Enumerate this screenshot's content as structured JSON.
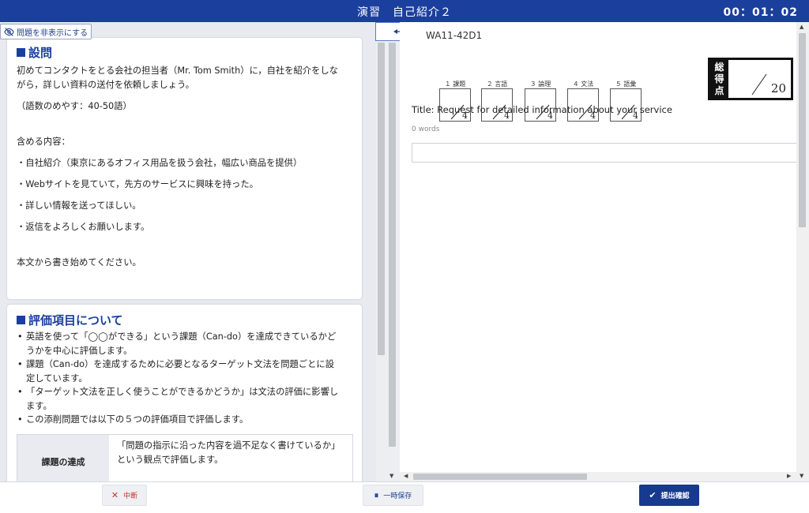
{
  "header": {
    "title": "演習　自己紹介２",
    "timer": "00：01：02"
  },
  "left": {
    "hide_button": "問題を非表示にする",
    "question_heading": "設問",
    "question_lines": [
      "初めてコンタクトをとる会社の担当者（Mr. Tom Smith）に，自社を紹介をしな",
      "がら，詳しい資料の送付を依頼しましょう。",
      "",
      "（語数のめやす：40-50語）",
      "",
      "",
      "",
      "含める内容：",
      "",
      "・自社紹介（東京にあるオフィス用品を扱う会社，幅広い商品を提供）",
      "",
      "・Webサイトを見ていて，先方のサービスに興味を持った。",
      "",
      "・詳しい情報を送ってほしい。",
      "",
      "・返信をよろしくお願いします。",
      "",
      "",
      "",
      "本文から書き始めてください。"
    ],
    "eval_heading": "評価項目について",
    "eval_items": [
      "英語を使って「◯◯ができる」という課題（Can-do）を達成できているかど",
      "うかを中心に評価します。",
      "課題（Can-do）を達成するために必要となるターゲット文法を問題ごとに設",
      "定しています。",
      "「ターゲット文法を正しく使うことができるかどうか」は文法の評価に影響し",
      "ます。",
      "この添削問題では以下の５つの評価項目で評価します。"
    ],
    "eval_table": {
      "header": "課題の達成",
      "desc_lines": [
        "「問題の指示に沿った内容を過不足なく書けているか」",
        "という観点で評価します。"
      ]
    }
  },
  "right": {
    "code": "WA11-42D1",
    "scores": [
      {
        "label": "１ 課題",
        "max": "4"
      },
      {
        "label": "２ 言語",
        "max": "4"
      },
      {
        "label": "３ 論理",
        "max": "4"
      },
      {
        "label": "４ 文法",
        "max": "4"
      },
      {
        "label": "５ 語彙",
        "max": "4"
      }
    ],
    "total_label_lines": [
      "総",
      "得",
      "点"
    ],
    "total_max": "20",
    "essay_title": "Title: Request for detailed information about your service",
    "word_count": "0 words",
    "answer_value": ""
  },
  "footer": {
    "suspend_label": "中断",
    "save_label": "一時保存",
    "submit_label": "提出確認"
  },
  "colors": {
    "brand": "#1b3f9c",
    "suspend": "#c0392b"
  },
  "icons": [
    "eye-slash-icon",
    "resize-horizontal-icon",
    "close-x-icon",
    "pause-icon",
    "check-icon"
  ]
}
